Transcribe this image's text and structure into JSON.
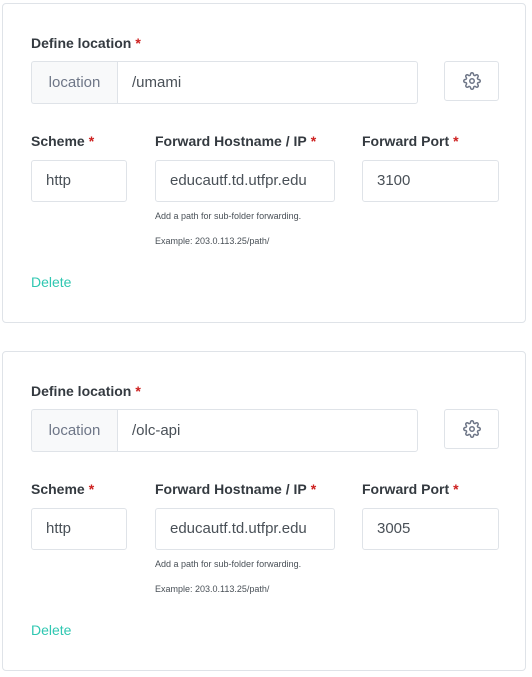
{
  "locations": [
    {
      "define_label": "Define location",
      "required_mark": "*",
      "prefix": "location",
      "path": "/umami",
      "scheme_label": "Scheme",
      "scheme_value": "http",
      "host_label": "Forward Hostname / IP",
      "host_value": "educautf.td.utfpr.edu",
      "port_label": "Forward Port",
      "port_value": "3100",
      "hint_line1": "Add a path for sub-folder forwarding.",
      "hint_line2": "Example: 203.0.113.25/path/",
      "delete_label": "Delete",
      "settings_icon": "gear-icon"
    },
    {
      "define_label": "Define location",
      "required_mark": "*",
      "prefix": "location",
      "path": "/olc-api",
      "scheme_label": "Scheme",
      "scheme_value": "http",
      "host_label": "Forward Hostname / IP",
      "host_value": "educautf.td.utfpr.edu",
      "port_label": "Forward Port",
      "port_value": "3005",
      "hint_line1": "Add a path for sub-folder forwarding.",
      "hint_line2": "Example: 203.0.113.25/path/",
      "delete_label": "Delete",
      "settings_icon": "gear-icon"
    }
  ],
  "colors": {
    "required": "#cd201f",
    "delete_link": "#2fc7b1",
    "border": "#dfe3e8"
  }
}
